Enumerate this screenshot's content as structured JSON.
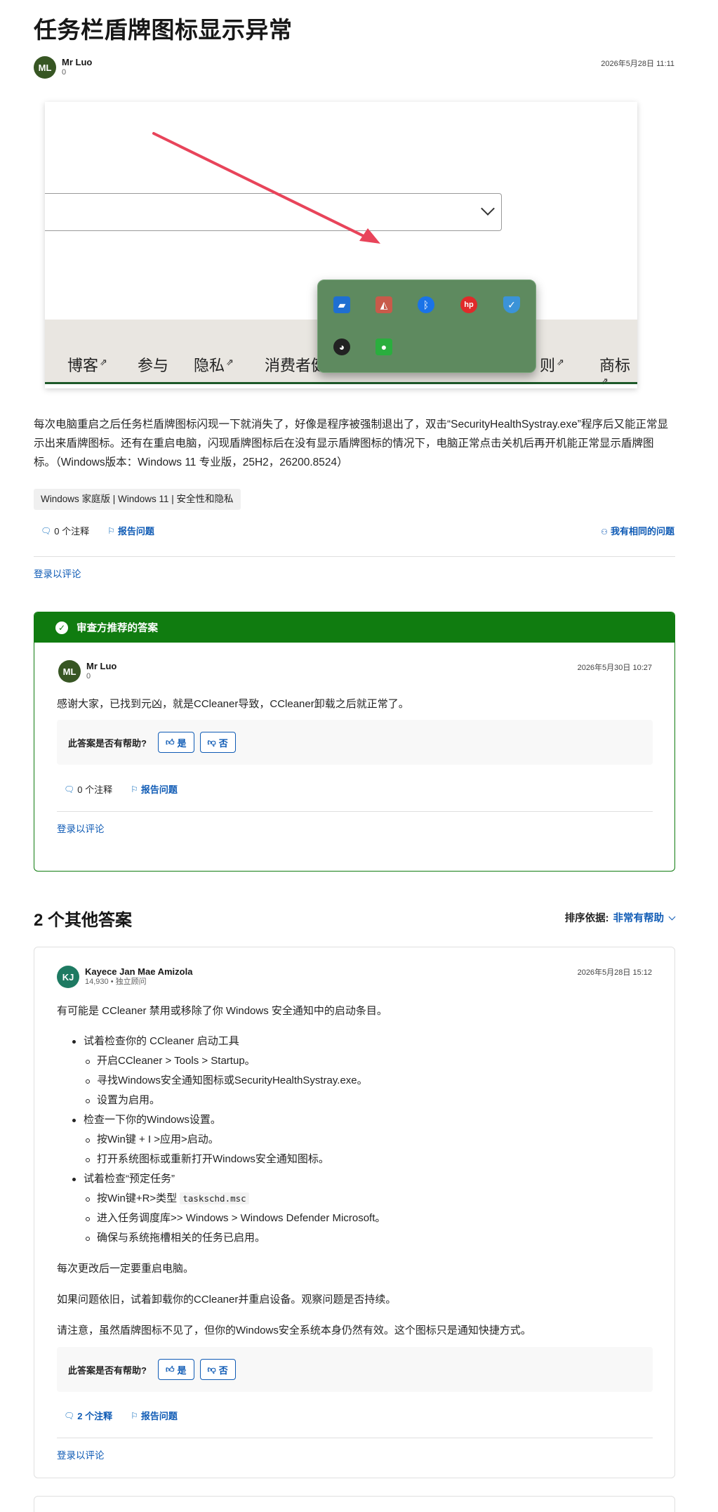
{
  "question": {
    "title": "任务栏盾牌图标显示异常",
    "author": {
      "initials": "ML",
      "name": "Mr Luo",
      "sub": "0"
    },
    "date": "2026年5月28日 11:11",
    "body": "每次电脑重启之后任务栏盾牌图标闪现一下就消失了，好像是程序被强制退出了，双击“SecurityHealthSystray.exe”程序后又能正常显示出来盾牌图标。还有在重启电脑，闪现盾牌图标后在没有显示盾牌图标的情况下，电脑正常点击关机后再开机能正常显示盾牌图标。（Windows版本：Windows 11 专业版，25H2，26200.8524）",
    "tag": "Windows 家庭版 | Windows 11 | 安全性和隐私",
    "comments": "0 个注释",
    "report": "报告问题",
    "same_question": "我有相同的问题",
    "signin": "登录以评论"
  },
  "screenshot": {
    "nav_items": [
      "博客",
      "参与",
      "隐私",
      "消费者健",
      "则",
      "商标"
    ],
    "nav_ext_flags": [
      true,
      false,
      true,
      false,
      true,
      true
    ],
    "tray_icons": [
      "app-icon",
      "network-icon",
      "bluetooth-icon",
      "hp-icon",
      "security-shield-icon",
      "qq-icon",
      "wechat-icon"
    ]
  },
  "accepted": {
    "header": "审查方推荐的答案",
    "author": {
      "initials": "ML",
      "name": "Mr Luo",
      "sub": "0"
    },
    "date": "2026年5月30日 10:27",
    "body": "感谢大家，已找到元凶，就是CCleaner导致，CCleaner卸载之后就正常了。",
    "helpful_q": "此答案是否有帮助?",
    "yes": "是",
    "no": "否",
    "comments": "0 个注释",
    "report": "报告问题",
    "signin": "登录以评论"
  },
  "others": {
    "title": "2 个其他答案",
    "sort_label": "排序依据:",
    "sort_value": "非常有帮助"
  },
  "answer2": {
    "author": {
      "initials": "KJ",
      "name": "Kayece Jan Mae Amizola",
      "sub": "14,930 • 独立顾问"
    },
    "date": "2026年5月28日 15:12",
    "intro": "有可能是 CCleaner 禁用或移除了你 Windows 安全通知中的启动条目。",
    "b1": "试着检查你的 CCleaner 启动工具",
    "b1s1": "开启CCleaner > Tools > Startup。",
    "b1s2": "寻找Windows安全通知图标或SecurityHealthSystray.exe。",
    "b1s3": "设置为启用。",
    "b2": "检查一下你的Windows设置。",
    "b2s1": "按Win键 + I >应用>启动。",
    "b2s2": "打开系统图标或重新打开Windows安全通知图标。",
    "b3": "试着检查“预定任务”",
    "b3s1_pre": "按Win键+R>类型 ",
    "b3s1_code": "taskschd.msc",
    "b3s2": "进入任务调度库>> Windows > Windows Defender Microsoft。",
    "b3s3": "确保与系统拖槽相关的任务已启用。",
    "p2": "每次更改后一定要重启电脑。",
    "p3": "如果问题依旧，试着卸载你的CCleaner并重启设备。观察问题是否持续。",
    "p4": "请注意，虽然盾牌图标不见了，但你的Windows安全系统本身仍然有效。这个图标只是通知快捷方式。",
    "helpful_q": "此答案是否有帮助?",
    "yes": "是",
    "no": "否",
    "comments": "2 个注释",
    "report": "报告问题",
    "signin": "登录以评论"
  }
}
